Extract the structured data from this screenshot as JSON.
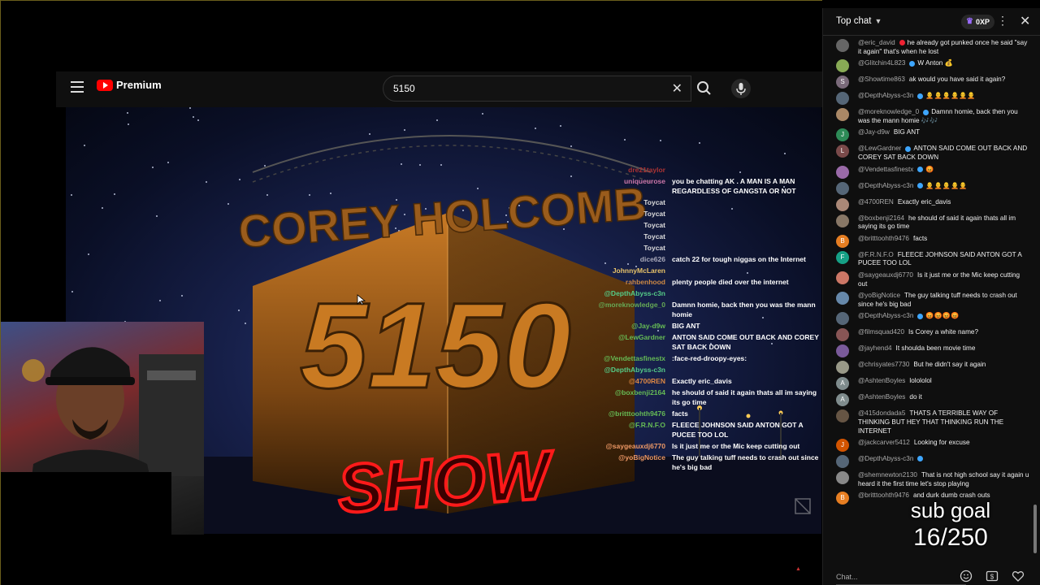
{
  "youtube": {
    "brand": "Premium",
    "search_value": "5150"
  },
  "video": {
    "title_top": "COREY HOLCOMB",
    "title_number": "5150",
    "title_show": "SHOW"
  },
  "overlay_chat": [
    {
      "user": "dre21taylor",
      "msg": "",
      "color": "#a33"
    },
    {
      "user": "uniqueurose",
      "msg": "you be chatting AK . A MAN IS A MAN REGARDLESS OF GANGSTA OR NOT",
      "color": "#c7a"
    },
    {
      "user": "Toycat",
      "msg": "",
      "color": "#ddd"
    },
    {
      "user": "Toycat",
      "msg": "",
      "color": "#ddd"
    },
    {
      "user": "Toycat",
      "msg": "",
      "color": "#ddd"
    },
    {
      "user": "Toycat",
      "msg": "",
      "color": "#ddd"
    },
    {
      "user": "Toycat",
      "msg": "",
      "color": "#ddd"
    },
    {
      "user": "dice626",
      "msg": "catch 22 for tough niggas on the Internet",
      "color": "#aab"
    },
    {
      "user": "JohnnyMcLaren",
      "msg": "",
      "color": "#e9c46a"
    },
    {
      "user": "rahbenhood",
      "msg": "plenty people died over the internet",
      "color": "#c84"
    },
    {
      "user": "@DepthAbyss-c3n",
      "msg": "",
      "color": "#5c8"
    },
    {
      "user": "@moreknowledge_0",
      "msg": "Damnn homie, back then you was the mann homie",
      "color": "#6a5"
    },
    {
      "user": "@Jay-d9w",
      "msg": "BIG ANT",
      "color": "#6b5"
    },
    {
      "user": "@LewGardner",
      "msg": "ANTON SAID COME OUT BACK AND COREY SAT BACK DOWN",
      "color": "#6b5"
    },
    {
      "user": "@Vendettasfinestx",
      "msg": ":face-red-droopy-eyes:",
      "color": "#6b5"
    },
    {
      "user": "@DepthAbyss-c3n",
      "msg": "",
      "color": "#5c8"
    },
    {
      "user": "@4700REN",
      "msg": "Exactly eric_davis",
      "color": "#d84"
    },
    {
      "user": "@boxbenji2164",
      "msg": "he should of said it again thats all im saying its go time",
      "color": "#6b5"
    },
    {
      "user": "@britttoohth9476",
      "msg": "facts",
      "color": "#6b5"
    },
    {
      "user": "@F.R.N.F.O",
      "msg": "FLEECE JOHNSON SAID ANTON GOT A PUCEE TOO LOL",
      "color": "#6b5"
    },
    {
      "user": "@saygeauxdj6770",
      "msg": "Is it just me or the Mic keep cutting out",
      "color": "#e96"
    },
    {
      "user": "@yoBigNotice",
      "msg": "The guy talking tuff needs to crash out since he's big bad",
      "color": "#e96"
    }
  ],
  "chat_panel": {
    "mode_label": "Top chat",
    "xp_label": "0XP",
    "input_placeholder": "Chat..."
  },
  "chat_messages": [
    {
      "author": "@eric_david",
      "text": "he already got punked once he said \"say it again\" that's when he lost",
      "avatar": "",
      "avatar_color": "#666",
      "badge": "red",
      "mod": false
    },
    {
      "author": "@Glitchin4L823",
      "text": "W Anton 💰",
      "avatar": "",
      "avatar_color": "#8a5",
      "badge": "verified",
      "mod": false
    },
    {
      "author": "@Showtime863",
      "text": "ak would you have said it again?",
      "avatar": "S",
      "avatar_color": "#7a6a7a",
      "badge": "",
      "mod": false
    },
    {
      "author": "@DepthAbyss-c3n",
      "text": "🧑‍🦲🧑‍🦲🧑‍🦲🧑‍🦲🧑‍🦲🧑‍🦲",
      "avatar": "",
      "avatar_color": "#567",
      "badge": "verified",
      "mod": false
    },
    {
      "author": "@moreknowledge_0",
      "text": "Damnn homie, back then you was the mann homie 🎶🎶",
      "avatar": "",
      "avatar_color": "#a86",
      "badge": "verified",
      "mod": false
    },
    {
      "author": "@Jay-d9w",
      "text": "BIG ANT",
      "avatar": "J",
      "avatar_color": "#2e8b57",
      "badge": "",
      "mod": false
    },
    {
      "author": "@LewGardner",
      "text": "ANTON SAID COME OUT BACK AND COREY SAT BACK DOWN",
      "avatar": "L",
      "avatar_color": "#7a4a4a",
      "badge": "verified",
      "mod": false
    },
    {
      "author": "@Vendettasfinestx",
      "text": "😡",
      "avatar": "",
      "avatar_color": "#9a6aa8",
      "badge": "verified",
      "mod": false
    },
    {
      "author": "@DepthAbyss-c3n",
      "text": "🧑‍🦲🧑‍🦲🧑‍🦲🧑‍🦲🧑‍🦲",
      "avatar": "",
      "avatar_color": "#567",
      "badge": "verified",
      "mod": false
    },
    {
      "author": "@4700REN",
      "text": "Exactly eric_davis",
      "avatar": "",
      "avatar_color": "#a87",
      "badge": "",
      "mod": false
    },
    {
      "author": "@boxbenji2164",
      "text": "he should of said it again thats all im saying its go time",
      "avatar": "",
      "avatar_color": "#876",
      "badge": "",
      "mod": false
    },
    {
      "author": "@britttoohth9476",
      "text": "facts",
      "avatar": "B",
      "avatar_color": "#e67e22",
      "badge": "",
      "mod": false
    },
    {
      "author": "@F.R.N.F.O",
      "text": "FLEECE JOHNSON SAID ANTON GOT A PUCEE TOO LOL",
      "avatar": "F",
      "avatar_color": "#16a085",
      "badge": "",
      "mod": false
    },
    {
      "author": "@saygeauxdj6770",
      "text": "Is it just me or the Mic keep cutting out",
      "avatar": "",
      "avatar_color": "#c76",
      "badge": "",
      "mod": false
    },
    {
      "author": "@yoBigNotice",
      "text": "The guy talking tuff needs to crash out since he's big bad",
      "avatar": "",
      "avatar_color": "#68a",
      "badge": "",
      "mod": false
    },
    {
      "author": "@DepthAbyss-c3n",
      "text": "😡😡😡😡",
      "avatar": "",
      "avatar_color": "#567",
      "badge": "verified",
      "mod": false
    },
    {
      "author": "@filmsquad420",
      "text": "Is Corey a white name?",
      "avatar": "",
      "avatar_color": "#855",
      "badge": "",
      "mod": false
    },
    {
      "author": "@jayhend4",
      "text": "It shoulda been movie time",
      "avatar": "",
      "avatar_color": "#7a5a9a",
      "badge": "",
      "mod": false
    },
    {
      "author": "@chrisyates7730",
      "text": "But he didn't say it again",
      "avatar": "",
      "avatar_color": "#998",
      "badge": "",
      "mod": false
    },
    {
      "author": "@AshtenBoyles",
      "text": "lolololol",
      "avatar": "A",
      "avatar_color": "#7f8c8d",
      "badge": "",
      "mod": false
    },
    {
      "author": "@AshtenBoyles",
      "text": "do it",
      "avatar": "A",
      "avatar_color": "#7f8c8d",
      "badge": "",
      "mod": false
    },
    {
      "author": "@415dondada5",
      "text": "THATS A TERRIBLE WAY OF THINKING BUT HEY THAT THINKING RUN THE INTERNET",
      "avatar": "",
      "avatar_color": "#654",
      "badge": "",
      "mod": false
    },
    {
      "author": "@jackcarver5412",
      "text": "Looking for excuse",
      "avatar": "J",
      "avatar_color": "#d35400",
      "badge": "",
      "mod": false
    },
    {
      "author": "@DepthAbyss-c3n",
      "text": "",
      "avatar": "",
      "avatar_color": "#567",
      "badge": "verified",
      "mod": false
    },
    {
      "author": "@shemnewton2130",
      "text": "That is not high school say it again u heard it the first time let's stop playing",
      "avatar": "",
      "avatar_color": "#888",
      "badge": "",
      "mod": false
    },
    {
      "author": "@britttoohth9476",
      "text": "and durk dumb crash outs",
      "avatar": "B",
      "avatar_color": "#e67e22",
      "badge": "",
      "mod": false
    }
  ],
  "sub_goal": {
    "label": "sub goal",
    "count": "16/250"
  },
  "colors": {
    "panel_bg": "#0f0f0f",
    "youtube_red": "#ff0000",
    "show_red": "#ff1a1a",
    "title_orange": "#d9852a"
  }
}
